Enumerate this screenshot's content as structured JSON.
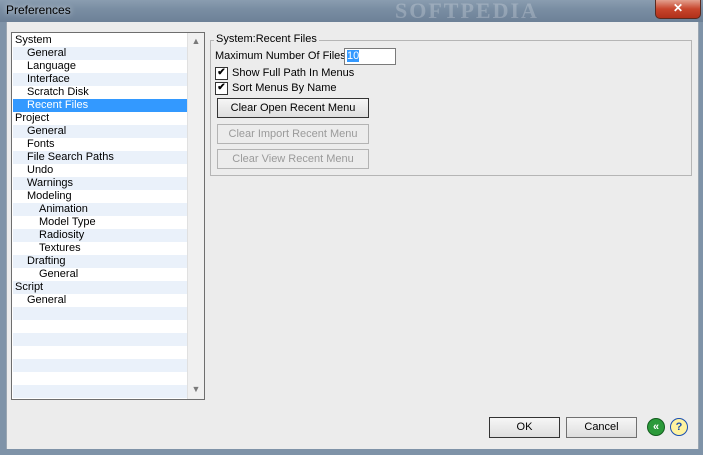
{
  "window": {
    "title": "Preferences",
    "watermark": "SOFTPEDIA",
    "close_glyph": "✕"
  },
  "tree": {
    "items": [
      {
        "label": "System",
        "level": 0
      },
      {
        "label": "General",
        "level": 1
      },
      {
        "label": "Language",
        "level": 1
      },
      {
        "label": "Interface",
        "level": 1
      },
      {
        "label": "Scratch Disk",
        "level": 1
      },
      {
        "label": "Recent Files",
        "level": 1,
        "selected": true
      },
      {
        "label": "Project",
        "level": 0
      },
      {
        "label": "General",
        "level": 1
      },
      {
        "label": "Fonts",
        "level": 1
      },
      {
        "label": "File Search Paths",
        "level": 1
      },
      {
        "label": "Undo",
        "level": 1
      },
      {
        "label": "Warnings",
        "level": 1
      },
      {
        "label": "Modeling",
        "level": 1
      },
      {
        "label": "Animation",
        "level": 2
      },
      {
        "label": "Model Type",
        "level": 2
      },
      {
        "label": "Radiosity",
        "level": 2
      },
      {
        "label": "Textures",
        "level": 2
      },
      {
        "label": "Drafting",
        "level": 1
      },
      {
        "label": "General",
        "level": 2
      },
      {
        "label": "Script",
        "level": 0
      },
      {
        "label": "General",
        "level": 1
      },
      {
        "label": "",
        "level": 0
      },
      {
        "label": "",
        "level": 0
      },
      {
        "label": "",
        "level": 0
      },
      {
        "label": "",
        "level": 0
      },
      {
        "label": "",
        "level": 0
      },
      {
        "label": "",
        "level": 0
      },
      {
        "label": "",
        "level": 0
      }
    ],
    "scroll_up_glyph": "▲",
    "scroll_down_glyph": "▼"
  },
  "panel": {
    "group_title": "System:Recent Files",
    "max_files_label": "Maximum Number Of Files",
    "max_files_value": "10",
    "show_full_path_label": "Show Full Path In Menus",
    "show_full_path_checked": true,
    "sort_by_name_label": "Sort Menus By Name",
    "sort_by_name_checked": true,
    "check_glyph": "✔",
    "clear_open_label": "Clear Open Recent Menu",
    "clear_import_label": "Clear Import Recent Menu",
    "clear_view_label": "Clear View Recent Menu"
  },
  "footer": {
    "ok_label": "OK",
    "cancel_label": "Cancel",
    "back_glyph": "«",
    "help_glyph": "?"
  },
  "colors": {
    "selection": "#3399ff",
    "help_icon": "#2b9a3a"
  }
}
